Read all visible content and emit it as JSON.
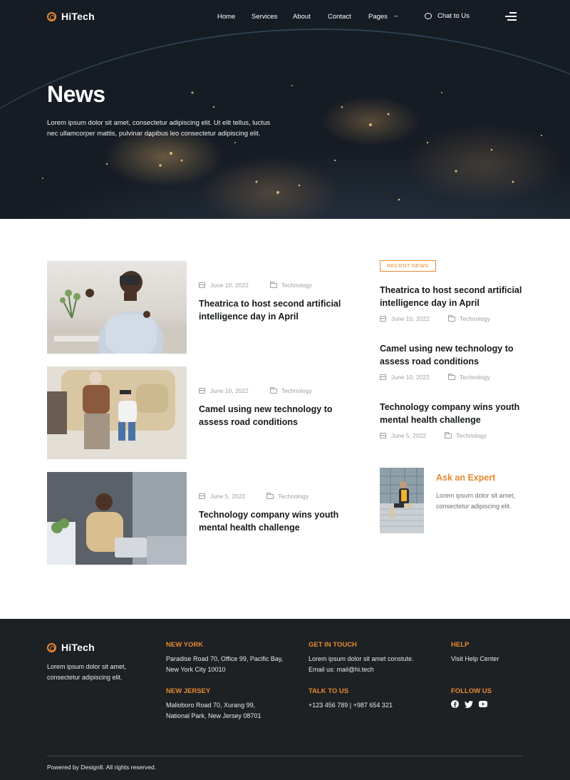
{
  "brand": {
    "name": "HiTech",
    "accent": "#e8892f"
  },
  "nav": {
    "items": [
      "Home",
      "Services",
      "About",
      "Contact",
      "Pages"
    ],
    "chat_label": "Chat to Us"
  },
  "hero": {
    "title": "News",
    "text": "Lorem ipsum dolor sit amet, consectetur adipiscing elit. Ut elit tellus, luctus nec ullamcorper mattis, pulvinar dapibus leo consectetur adipiscing elit."
  },
  "articles": [
    {
      "date": "June 10, 2022",
      "category": "Technology",
      "title": "Theatrica to host second artificial intelligence day in April"
    },
    {
      "date": "June 10, 2022",
      "category": "Technology",
      "title": "Camel using new technology to assess road conditions"
    },
    {
      "date": "June 5, 2022",
      "category": "Technology",
      "title": "Technology company wins youth mental health challenge"
    }
  ],
  "sidebar": {
    "badge": "RECENT NEWS",
    "recent": [
      {
        "title": "Theatrica to host second artificial intelligence day in April",
        "date": "June 10, 2022",
        "category": "Technology"
      },
      {
        "title": "Camel using new technology to assess road conditions",
        "date": "June 10, 2022",
        "category": "Technology"
      },
      {
        "title": "Technology company wins youth mental health challenge",
        "date": "June 5, 2022",
        "category": "Technology"
      }
    ],
    "expert": {
      "title": "Ask an Expert",
      "text": "Lorem ipsum dolor sit amet, consectetur adipiscing elit."
    }
  },
  "footer": {
    "brand": "HiTech",
    "description": "Lorem ipsum dolor sit amet, consectetur adipiscing elit.",
    "new_york": {
      "heading": "NEW YORK",
      "text": "Paradise Road 70, Office 99, Pacific Bay,  New York City 10010"
    },
    "new_jersey": {
      "heading": "NEW JERSEY",
      "text": "Malioboro Road 70, Xurang 99, National Park, New Jersey 08701"
    },
    "get_in_touch": {
      "heading": "GET IN TOUCH",
      "text": "Lorem ipsum dolor sit amet constute. Email us: mail@hi.tech"
    },
    "talk_to_us": {
      "heading": "TALK TO US",
      "text": "+123 456 789 | +987 654 321"
    },
    "help": {
      "heading": "HELP",
      "link": "Visit Help Center"
    },
    "follow": {
      "heading": "FOLLOW US",
      "icons": [
        "facebook-icon",
        "twitter-icon",
        "youtube-icon"
      ]
    },
    "copyright": "Powered by Design8. All rights reserved."
  }
}
